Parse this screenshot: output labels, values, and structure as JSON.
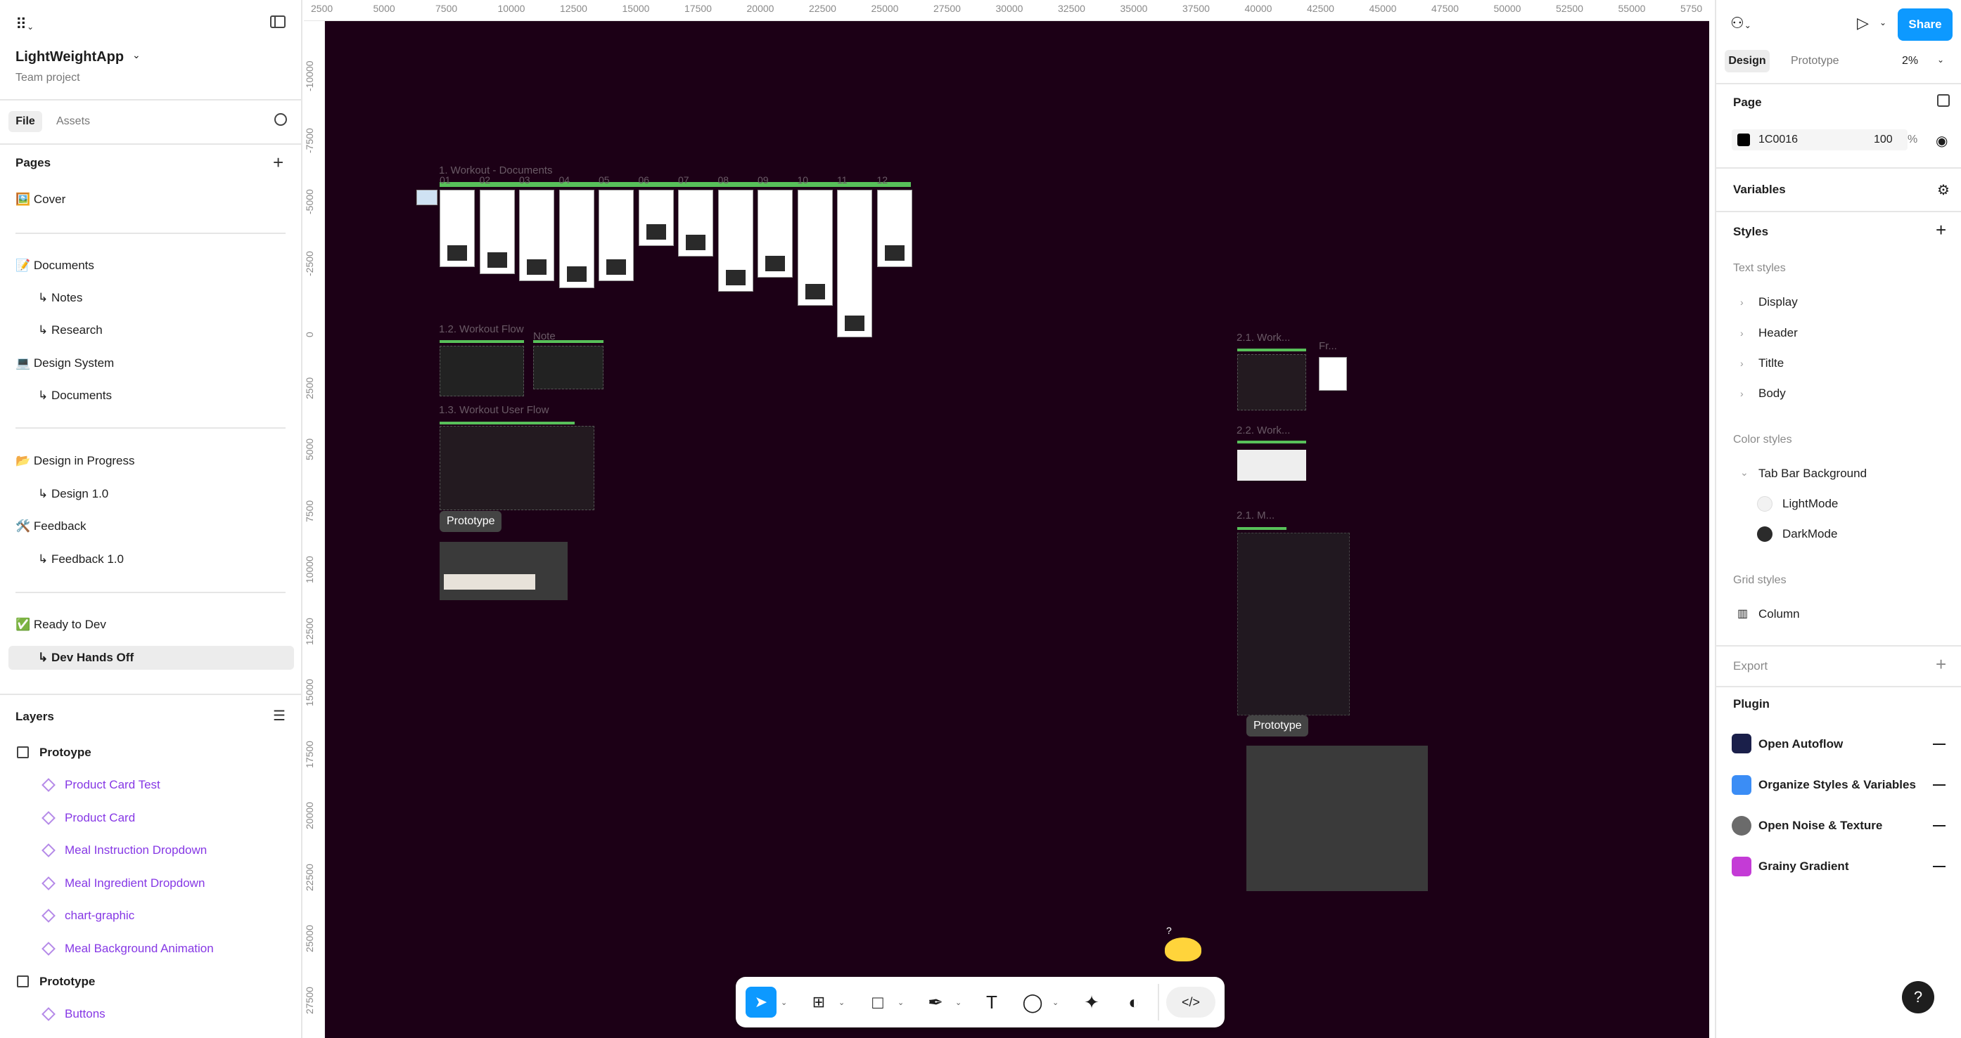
{
  "app": {
    "project_name": "LightWeightApp",
    "team_label": "Team project"
  },
  "left_tabs": {
    "file": "File",
    "assets": "Assets"
  },
  "pages_section": {
    "title": "Pages",
    "items": [
      {
        "label": "🖼️ Cover"
      },
      {
        "label": "📝 Documents"
      },
      {
        "label": "↳ Notes"
      },
      {
        "label": "↳ Research"
      },
      {
        "label": "💻 Design System"
      },
      {
        "label": "↳ Documents"
      },
      {
        "label": "📂 Design in Progress"
      },
      {
        "label": "↳ Design 1.0"
      },
      {
        "label": "🛠️ Feedback"
      },
      {
        "label": "↳ Feedback 1.0"
      },
      {
        "label": "✅ Ready to Dev"
      },
      {
        "label": "↳ Dev Hands Off"
      }
    ],
    "selected": "↳ Dev Hands Off"
  },
  "layers_section": {
    "title": "Layers",
    "groups": [
      {
        "name": "Protoype",
        "children": [
          "Product Card Test",
          "Product Card",
          "Meal Instruction Dropdown",
          "Meal Ingredient Dropdown",
          "chart-graphic",
          "Meal Background Animation"
        ]
      },
      {
        "name": "Prototype",
        "children": [
          "Buttons"
        ]
      }
    ]
  },
  "ruler": {
    "top": [
      "2500",
      "5000",
      "7500",
      "10000",
      "12500",
      "15000",
      "17500",
      "20000",
      "22500",
      "25000",
      "27500",
      "30000",
      "32500",
      "35000",
      "37500",
      "40000",
      "42500",
      "45000",
      "47500",
      "50000",
      "52500",
      "55000",
      "5750"
    ],
    "left": [
      "-10000",
      "-7500",
      "-5000",
      "-2500",
      "0",
      "2500",
      "5000",
      "7500",
      "10000",
      "12500",
      "15000",
      "17500",
      "20000",
      "22500",
      "25000",
      "27500"
    ]
  },
  "canvas": {
    "background": "#1C0016",
    "labels": {
      "workout_docs": "1. Workout - Documents",
      "workout_flow": "1.2. Workout Flow",
      "note": "Note",
      "user_flow": "1.3. Workout User Flow",
      "work_21": "2.1. Work...",
      "fr": "Fr...",
      "work_22": "2.2. Work...",
      "m_21": "2.1. M...",
      "prototype_a": "Prototype",
      "prototype_b": "Prototype"
    },
    "doc_numbers": [
      "01",
      "02",
      "03",
      "04",
      "05",
      "06",
      "07",
      "08",
      "09",
      "10",
      "11",
      "12"
    ]
  },
  "right_panel": {
    "tabs": {
      "design": "Design",
      "prototype": "Prototype"
    },
    "zoom": "2%",
    "share": "Share",
    "page_title": "Page",
    "page_color": {
      "hex": "1C0016",
      "opacity": "100",
      "unit": "%"
    },
    "variables": "Variables",
    "styles": "Styles",
    "text_styles_label": "Text styles",
    "text_styles": [
      "Display",
      "Header",
      "Titlte",
      "Body"
    ],
    "color_styles_label": "Color styles",
    "color_group": "Tab Bar Background",
    "colors": [
      {
        "name": "LightMode",
        "hex": "#F2F2F2"
      },
      {
        "name": "DarkMode",
        "hex": "#2B2B2B"
      }
    ],
    "grid_styles_label": "Grid styles",
    "grid_styles": [
      "Column"
    ],
    "export": "Export",
    "plugin": "Plugin",
    "plugins": [
      {
        "name": "Open Autoflow",
        "color": "#1a1f4a",
        "icon": "autoflow-icon"
      },
      {
        "name": "Organize Styles & Variables",
        "color": "#3b8df5",
        "icon": "organize-icon"
      },
      {
        "name": "Open Noise & Texture",
        "color": "#6b6b6b",
        "icon": "noise-icon"
      },
      {
        "name": "Grainy Gradient",
        "color": "#c43bd6",
        "icon": "gradient-icon"
      }
    ]
  },
  "help": "?"
}
